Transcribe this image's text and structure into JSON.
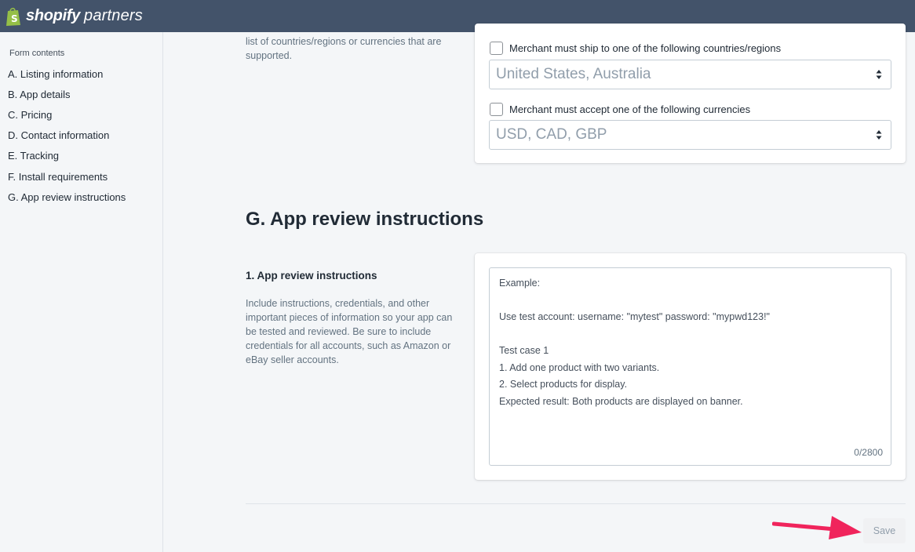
{
  "header": {
    "brand": "shopify",
    "brand_sub": "partners"
  },
  "sidebar": {
    "heading": "Form contents",
    "items": [
      {
        "label": "A. Listing information"
      },
      {
        "label": "B. App details"
      },
      {
        "label": "C. Pricing"
      },
      {
        "label": "D. Contact information"
      },
      {
        "label": "E. Tracking"
      },
      {
        "label": "F. Install requirements"
      },
      {
        "label": "G. App review instructions"
      }
    ]
  },
  "install_requirements": {
    "desc_partial": "list of countries/regions or currencies that are supported.",
    "ship_checkbox_label": "Merchant must ship to one of the following countries/regions",
    "ship_select_placeholder": "United States, Australia",
    "currency_checkbox_label": "Merchant must accept one of the following currencies",
    "currency_select_placeholder": "USD, CAD, GBP"
  },
  "review": {
    "section_title": "G. App review instructions",
    "field_title": "1. App review instructions",
    "field_desc": "Include instructions, credentials, and other important pieces of information so your app can be tested and reviewed. Be sure to include credentials for all accounts, such as Amazon or eBay seller accounts.",
    "placeholder_lines": [
      "Example:",
      "",
      "Use test account: username: \"mytest\" password: \"mypwd123!\"",
      "",
      "Test case 1",
      "1. Add one product with two variants.",
      "2. Select products for display.",
      "Expected result: Both products are displayed on banner."
    ],
    "counter": "0/2800"
  },
  "footer": {
    "save_label": "Save"
  },
  "colors": {
    "topbar": "#43536a",
    "logo_green": "#95bf47",
    "annotation_arrow": "#f0245c"
  }
}
